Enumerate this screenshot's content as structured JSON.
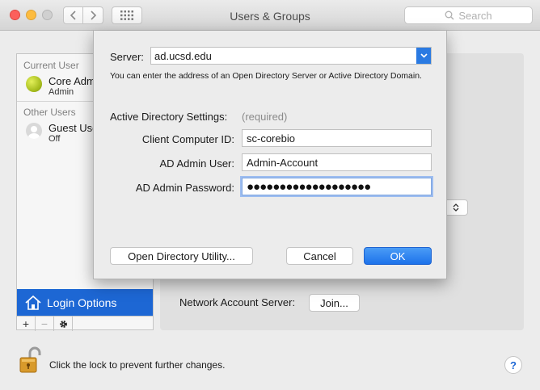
{
  "window": {
    "title": "Users & Groups"
  },
  "search": {
    "placeholder": "Search"
  },
  "sidebar": {
    "current_user_header": "Current User",
    "current_user": {
      "name": "Core Admin",
      "role": "Admin"
    },
    "other_users_header": "Other Users",
    "other_user": {
      "name": "Guest User",
      "status": "Off"
    },
    "login_options_label": "Login Options",
    "add": "+",
    "remove": "−"
  },
  "main": {
    "network_account_server_label": "Network Account Server:",
    "join_button": "Join..."
  },
  "footer": {
    "lock_text": "Click the lock to prevent further changes.",
    "help": "?"
  },
  "sheet": {
    "server_label": "Server:",
    "server_value": "ad.ucsd.edu",
    "server_note": "You can enter the address of an Open Directory Server or Active Directory Domain.",
    "ad_settings_label": "Active Directory Settings:",
    "required_label": "(required)",
    "client_id_label": "Client Computer ID:",
    "client_id_value": "sc-corebio",
    "admin_user_label": "AD Admin User:",
    "admin_user_value": "Admin-Account",
    "admin_password_label": "AD Admin Password:",
    "admin_password_mask": "●●●●●●●●●●●●●●●●●●●",
    "open_directory_button": "Open Directory Utility...",
    "cancel_button": "Cancel",
    "ok_button": "OK"
  },
  "colors": {
    "accent": "#1d67d4",
    "ok_button": "#1d72ea"
  }
}
